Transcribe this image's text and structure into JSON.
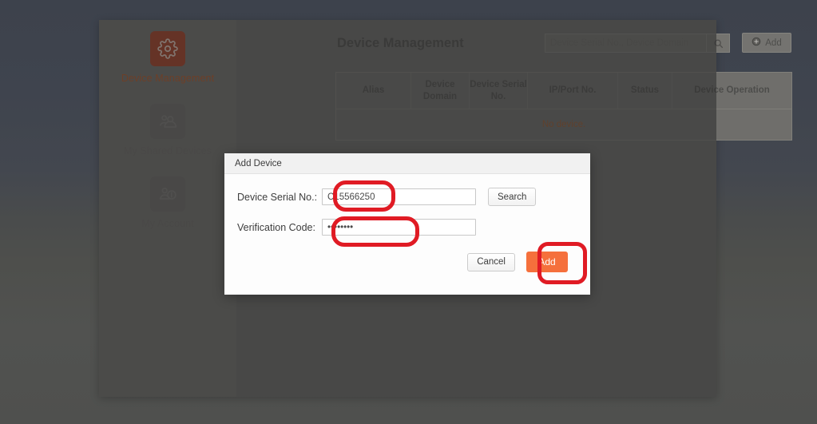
{
  "sidebar": {
    "items": [
      {
        "label": "Device Management",
        "icon": "gear-icon",
        "active": true
      },
      {
        "label": "My Shared Devices",
        "icon": "group-users-icon",
        "active": false
      },
      {
        "label": "My Account",
        "icon": "user-account-icon",
        "active": false
      }
    ]
  },
  "main": {
    "page_title": "Device Management",
    "search": {
      "placeholder": "Device Serial No., Device Domain",
      "value": "",
      "icon": "search-icon"
    },
    "add_button": {
      "label": "Add",
      "icon": "plus-circle-icon"
    },
    "table": {
      "columns": [
        "Alias",
        "Device Domain",
        "Device Serial No.",
        "IP/Port No.",
        "Status",
        "Device Operation"
      ],
      "empty_message": "No device.",
      "rows": []
    }
  },
  "modal": {
    "title": "Add Device",
    "fields": [
      {
        "label": "Device Serial No.:",
        "value": "C15566250",
        "type": "text"
      },
      {
        "label": "Verification Code:",
        "value": "••••••••",
        "type": "password"
      }
    ],
    "search_button": "Search",
    "cancel_button": "Cancel",
    "confirm_button": "Add"
  },
  "colors": {
    "accent_orange": "#f5703c",
    "annotation_red": "#e01b24",
    "active_icon_bg": "#b03a1c",
    "empty_text": "#a35a2a"
  }
}
